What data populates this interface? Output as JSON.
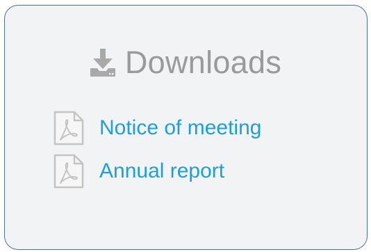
{
  "downloads": {
    "title": "Downloads",
    "items": [
      {
        "label": "Notice of meeting",
        "icon": "pdf-file-icon"
      },
      {
        "label": "Annual report",
        "icon": "pdf-file-icon"
      }
    ]
  },
  "colors": {
    "panel_background": "#f1f3f4",
    "panel_border": "#4c6ea6",
    "title": "#9a9a9a",
    "link": "#1e9fd8",
    "icon": "#c4c4c4"
  }
}
